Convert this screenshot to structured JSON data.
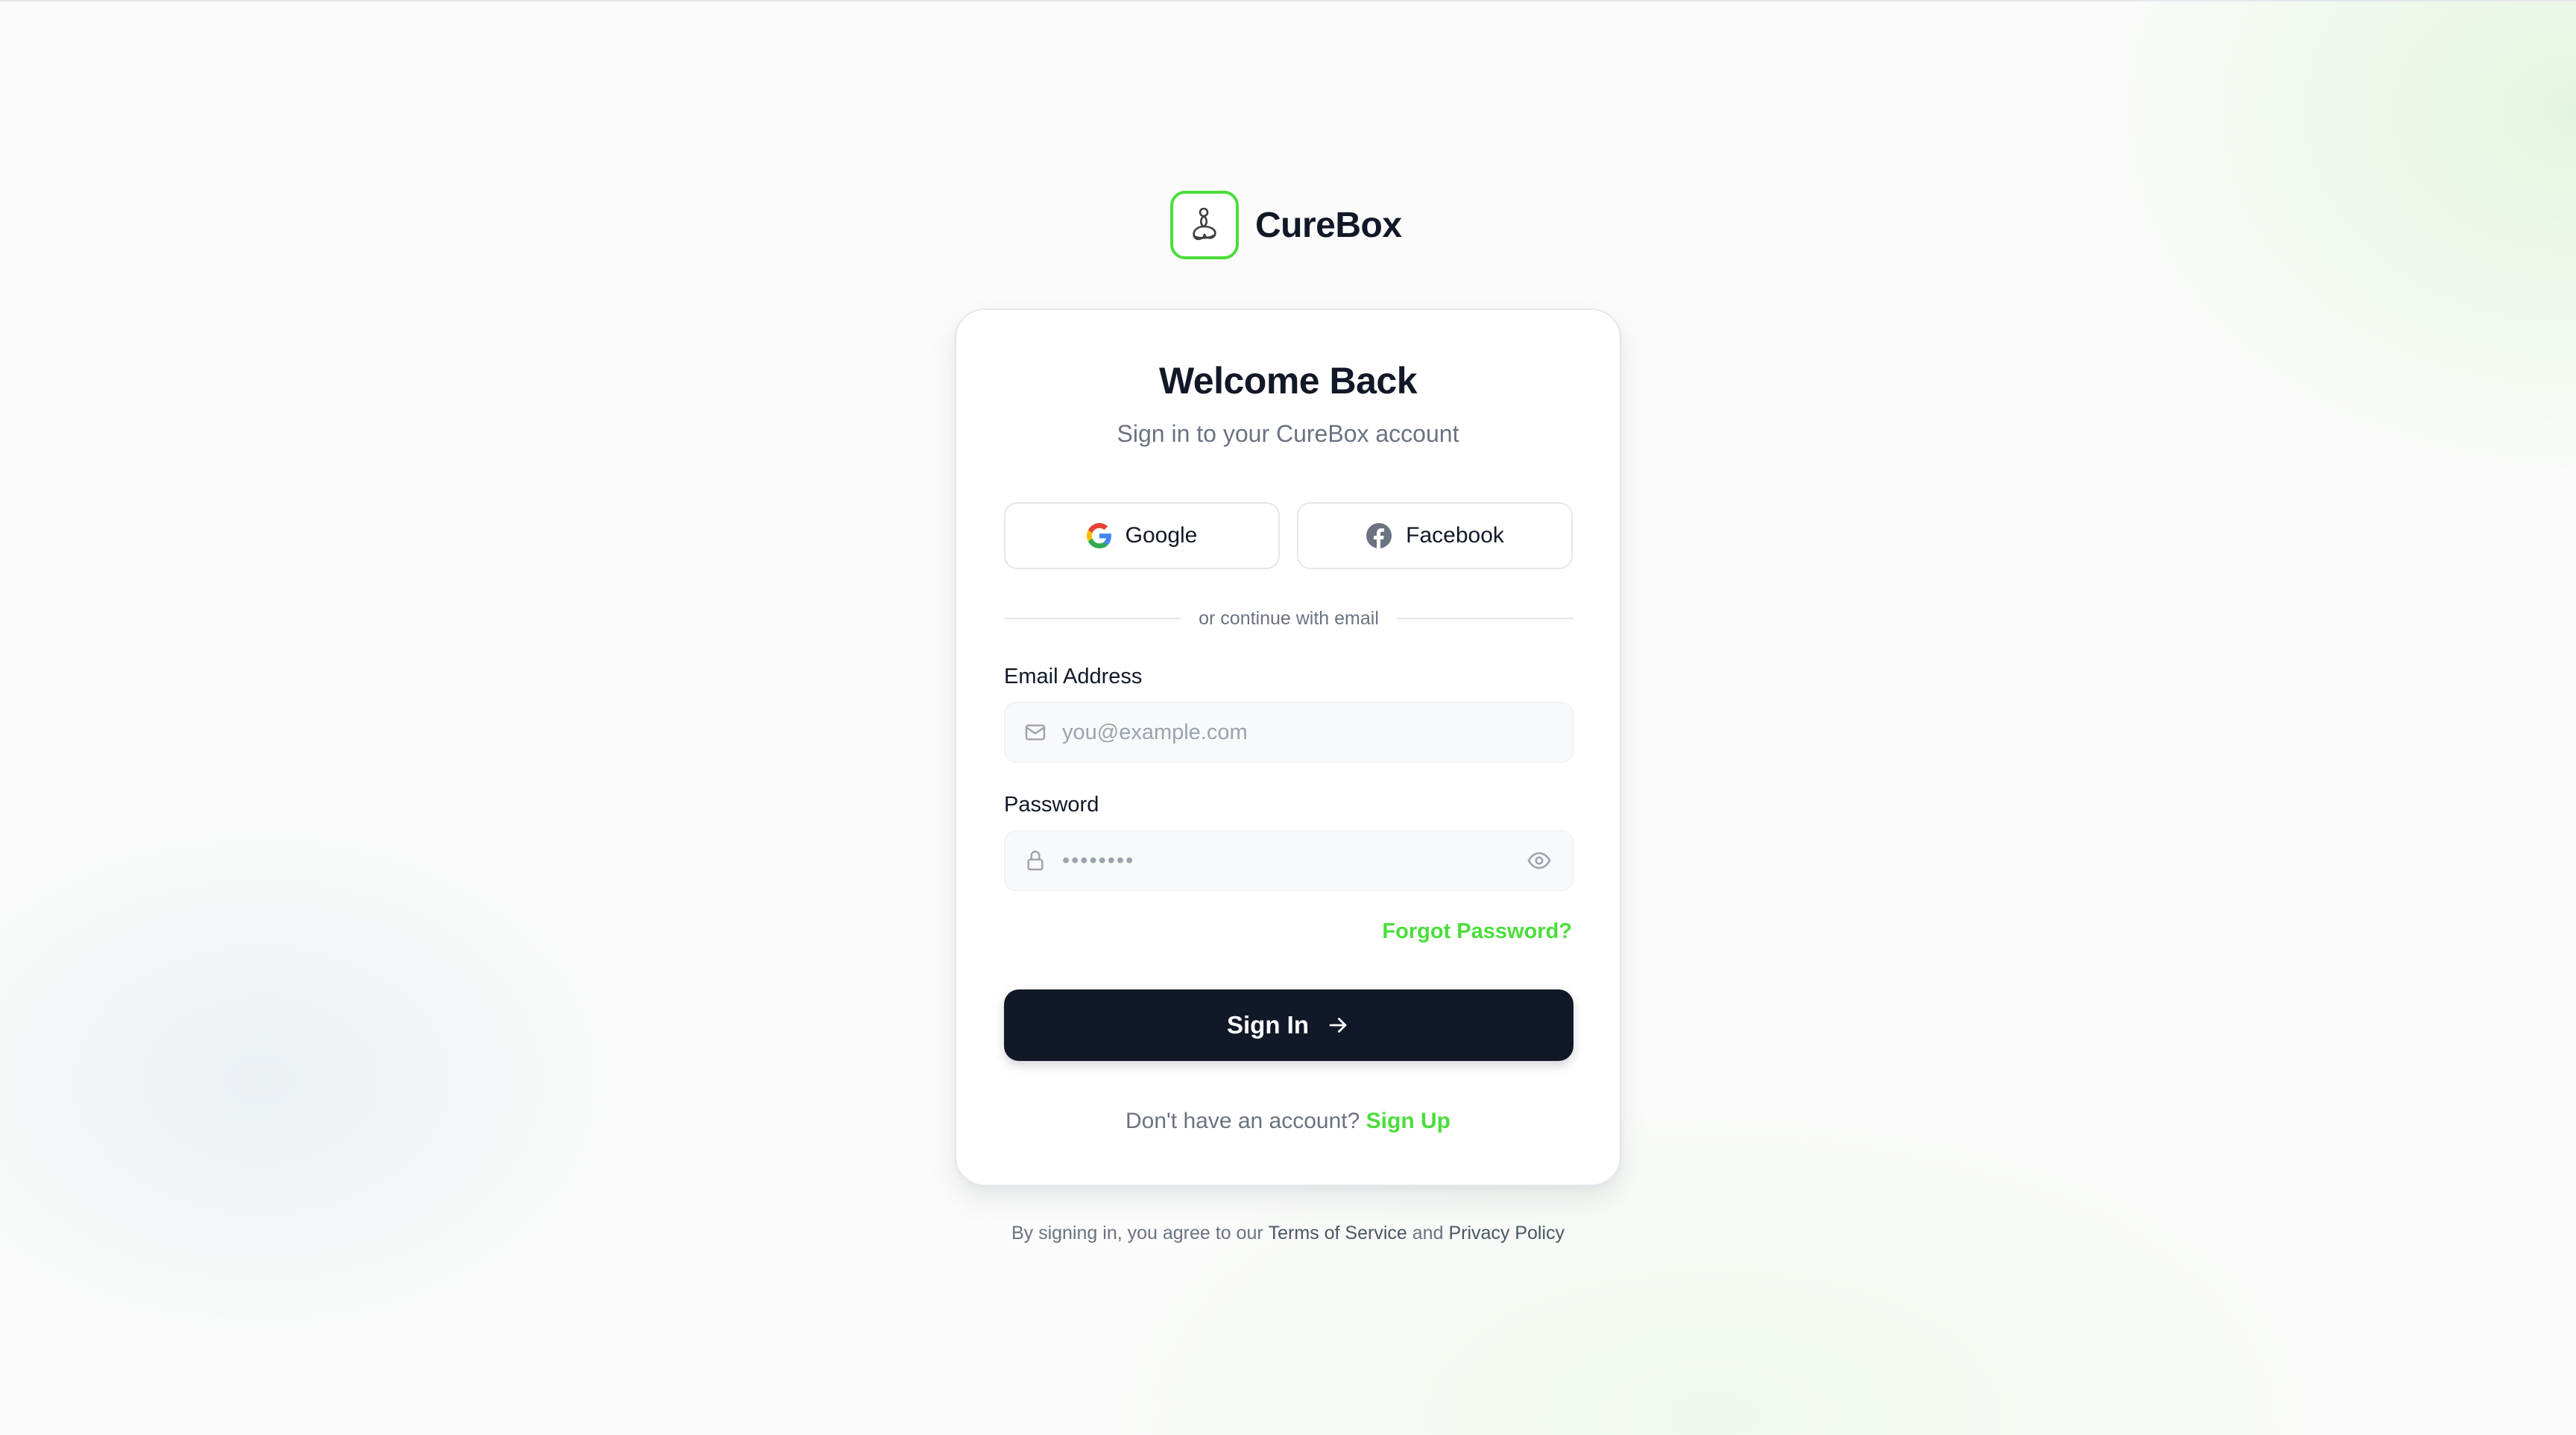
{
  "brand": {
    "name": "CureBox",
    "logo_icon": "meditation-figure-icon",
    "accent": "#4ade3a"
  },
  "card": {
    "title": "Welcome Back",
    "subtitle": "Sign in to your CureBox account",
    "social": {
      "google_label": "Google",
      "facebook_label": "Facebook"
    },
    "divider_text": "or continue with email",
    "email": {
      "label": "Email Address",
      "placeholder": "you@example.com",
      "value": ""
    },
    "password": {
      "label": "Password",
      "masked_value": "••••••••"
    },
    "forgot_label": "Forgot Password?",
    "signin_label": "Sign In",
    "signup_prompt": "Don't have an account?",
    "signup_label": "Sign Up"
  },
  "footer": {
    "prefix": "By signing in, you agree to our",
    "terms": "Terms of Service",
    "and": "and",
    "privacy": "Privacy Policy"
  },
  "colors": {
    "primary_dark": "#111827",
    "accent_green": "#4ade3a",
    "muted_text": "#6b7280"
  }
}
